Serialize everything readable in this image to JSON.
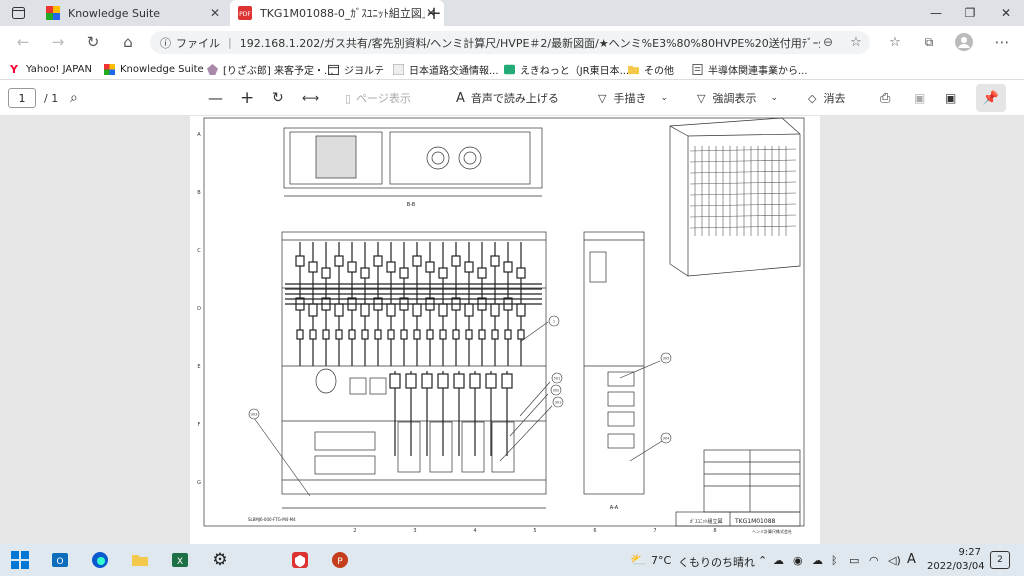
{
  "tabs": [
    {
      "title": "Knowledge Suite",
      "active": false
    },
    {
      "title": "TKG1M01088-0_ｶﾞｽﾕﾆｯﾄ組立図」",
      "active": true
    }
  ],
  "address": {
    "scheme_label": "ファイル",
    "url": "192.168.1.202/ガス共有/客先別資料/ヘンミ計算尺/HVPE＃2/最新図面/★ヘンミ%E3%80%80HVPE%20送付用ﾃﾞｰﾀ/ｶﾞｽ供..."
  },
  "bookmarks": [
    {
      "label": "Yahoo! JAPAN",
      "icon": "yahoo-icon"
    },
    {
      "label": "Knowledge Suite",
      "icon": "ks-icon"
    },
    {
      "label": "[りざぶ郎] 来客予定・...",
      "icon": "reserve-icon"
    },
    {
      "label": "ジヨルテ",
      "icon": "calendar-icon"
    },
    {
      "label": "日本道路交通情報...",
      "icon": "road-icon"
    },
    {
      "label": "えきねっと（JR東日本...",
      "icon": "train-icon"
    },
    {
      "label": "その他",
      "icon": "folder-icon"
    },
    {
      "label": "半導体関連事業から...",
      "icon": "doc-icon"
    }
  ],
  "pdf_toolbar": {
    "page_current": "1",
    "page_total": "/ 1",
    "page_view": "ページ表示",
    "read_aloud": "音声で読み上げる",
    "draw": "手描き",
    "highlight": "強調表示",
    "erase": "消去"
  },
  "drawing": {
    "title_number": "TKG1M01088",
    "title_name": "ｶﾞｽﾕﾆｯﾄ組立図",
    "company": "ヘンミ計算尺株式会社",
    "view_label_plan": "B-B",
    "view_label_side": "A-A",
    "part_ref": "SL8MJ6-000-FTG-M4-M4",
    "col_numbers": [
      "2",
      "3",
      "4",
      "5",
      "6",
      "7",
      "8"
    ],
    "row_letters": [
      "A",
      "B",
      "C",
      "D",
      "E",
      "F",
      "G"
    ],
    "callouts": [
      "1",
      "303",
      "501",
      "302",
      "301",
      "305",
      "304",
      "306"
    ]
  },
  "taskbar": {
    "weather_temp": "7°C",
    "weather_text": "くもりのち晴れ",
    "ime": "A",
    "time": "9:27",
    "date": "2022/03/04",
    "notifications": "2"
  },
  "colors": {
    "edge_blue": "#0c59cf",
    "accent_red": "#d33",
    "excel_green": "#1d7044",
    "outlook_blue": "#0f6cbd",
    "ppt_orange": "#c43e1c"
  }
}
